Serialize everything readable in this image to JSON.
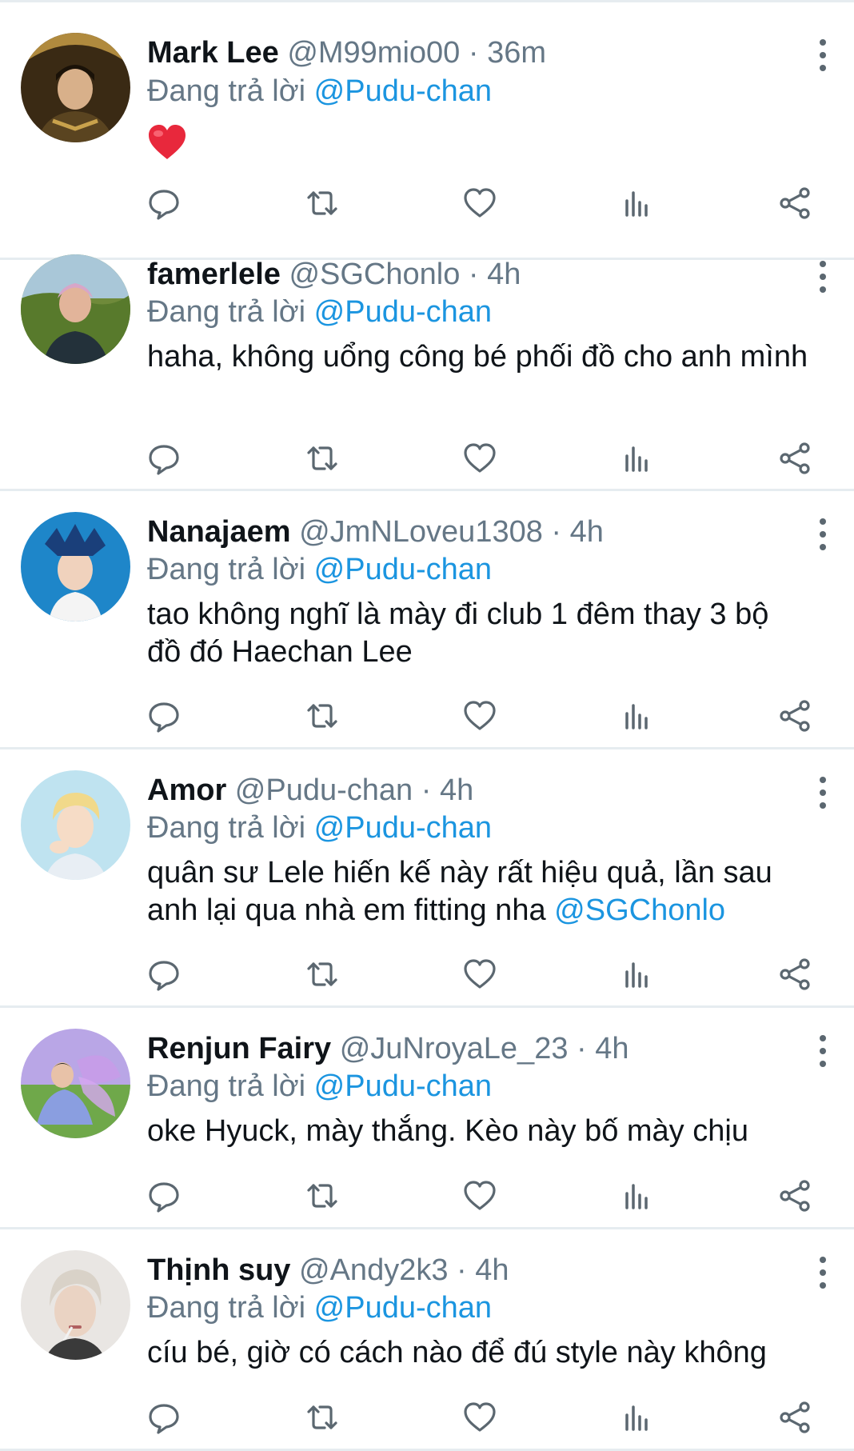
{
  "reply_prefix": "Đang trả lời",
  "reply_target": "@Pudu-chan",
  "separator": "·",
  "tweets": [
    {
      "display_name": "Mark Lee",
      "handle": "@M99mio00",
      "time": "36m",
      "text": "",
      "emoji": "red-heart-emoji"
    },
    {
      "display_name": "famerlele",
      "handle": "@SGChonlo",
      "time": "4h",
      "text": "haha, không uổng công bé phối đồ cho anh mình"
    },
    {
      "display_name": "Nanajaem",
      "handle": "@JmNLoveu1308",
      "time": "4h",
      "text": "tao không nghĩ là mày đi club 1 đêm thay 3 bộ đồ đó Haechan Lee"
    },
    {
      "display_name": "Amor",
      "handle": "@Pudu-chan",
      "time": "4h",
      "text": "quân sư Lele hiến kế này rất hiệu quả, lần sau anh lại qua nhà em fitting nha",
      "text_mention": "@SGChonlo"
    },
    {
      "display_name": "Renjun Fairy",
      "handle": "@JuNroyaLe_23",
      "time": "4h",
      "text": "oke Hyuck, mày thắng. Kèo này bố mày chịu"
    },
    {
      "display_name": "Thịnh suy",
      "handle": "@Andy2k3",
      "time": "4h",
      "text": "cíu bé, giờ có cách nào để đú style này không"
    }
  ],
  "colors": {
    "text": "#0f1419",
    "secondary": "#657786",
    "link": "#1b95e0",
    "divider": "#e6ecf0",
    "heart": "#e0245e"
  },
  "icons": [
    "reply-icon",
    "retweet-icon",
    "like-icon",
    "stats-icon",
    "share-icon",
    "more-options-icon"
  ]
}
